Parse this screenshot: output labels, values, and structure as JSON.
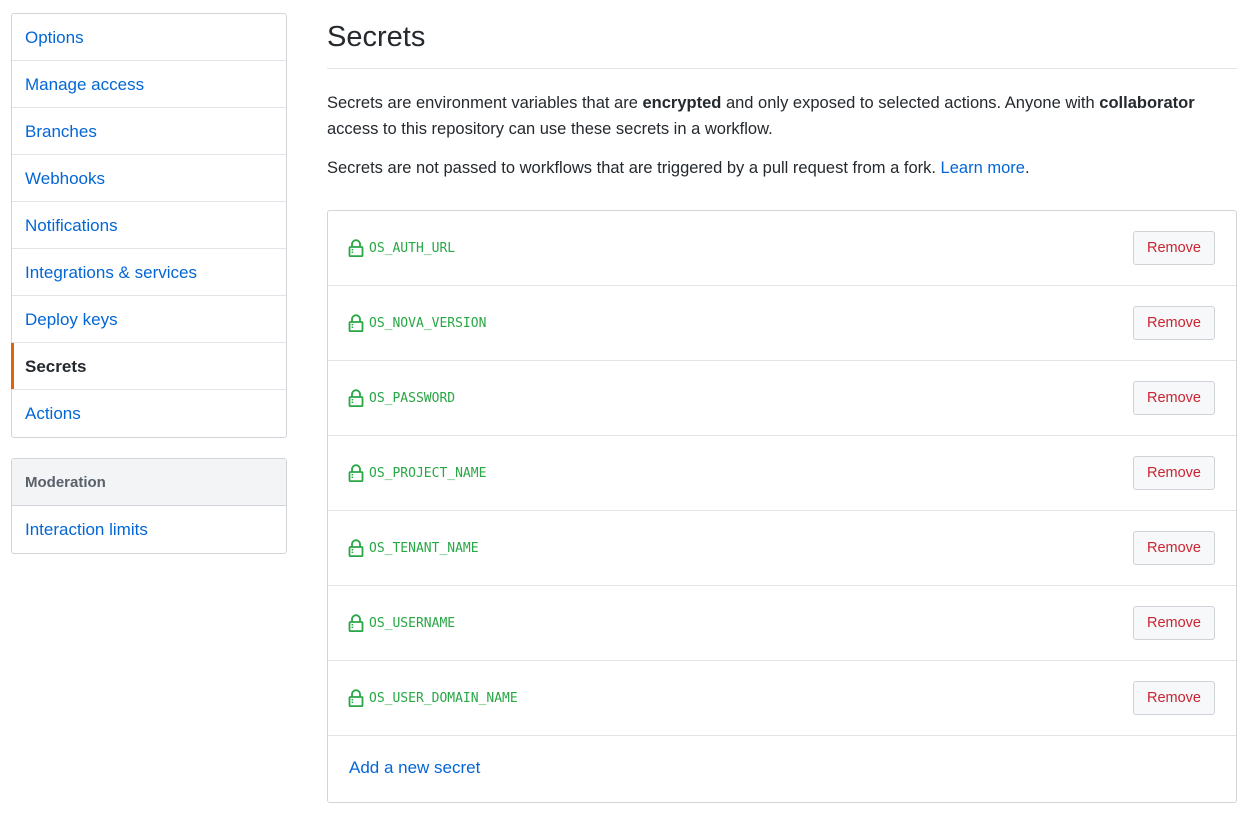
{
  "sidebar": {
    "items": [
      {
        "label": "Options",
        "selected": false
      },
      {
        "label": "Manage access",
        "selected": false
      },
      {
        "label": "Branches",
        "selected": false
      },
      {
        "label": "Webhooks",
        "selected": false
      },
      {
        "label": "Notifications",
        "selected": false
      },
      {
        "label": "Integrations & services",
        "selected": false
      },
      {
        "label": "Deploy keys",
        "selected": false
      },
      {
        "label": "Secrets",
        "selected": true
      },
      {
        "label": "Actions",
        "selected": false
      }
    ],
    "moderation": {
      "heading": "Moderation",
      "items": [
        {
          "label": "Interaction limits"
        }
      ]
    }
  },
  "main": {
    "title": "Secrets",
    "description": {
      "p1_a": "Secrets are environment variables that are ",
      "p1_b": "encrypted",
      "p1_c": " and only exposed to selected actions. Anyone with ",
      "p1_d": "collaborator",
      "p1_e": " access to this repository can use these secrets in a workflow.",
      "p2_a": "Secrets are not passed to workflows that are triggered by a pull request from a fork. ",
      "p2_link": "Learn more",
      "p2_end": "."
    },
    "secrets": [
      {
        "name": "OS_AUTH_URL",
        "action": "Remove"
      },
      {
        "name": "OS_NOVA_VERSION",
        "action": "Remove"
      },
      {
        "name": "OS_PASSWORD",
        "action": "Remove"
      },
      {
        "name": "OS_PROJECT_NAME",
        "action": "Remove"
      },
      {
        "name": "OS_TENANT_NAME",
        "action": "Remove"
      },
      {
        "name": "OS_USERNAME",
        "action": "Remove"
      },
      {
        "name": "OS_USER_DOMAIN_NAME",
        "action": "Remove"
      }
    ],
    "add_secret_label": "Add a new secret"
  },
  "colors": {
    "link": "#0366d6",
    "secret_green": "#28a745",
    "danger": "#cb2431",
    "selected_accent": "#e36209"
  },
  "icons": {
    "secret": "lock-icon"
  }
}
